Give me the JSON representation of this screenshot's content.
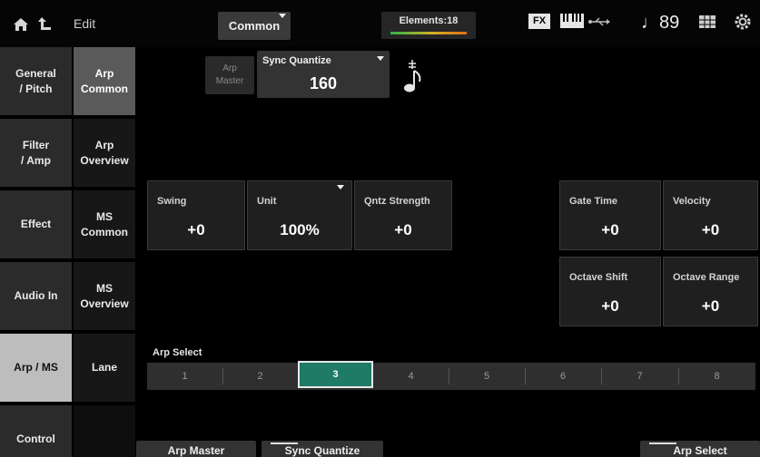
{
  "header": {
    "edit_label": "Edit",
    "common_label": "Common",
    "elements_label": "Elements:18",
    "fx_label": "FX",
    "tempo_label": "♩89",
    "icons": [
      "home-icon",
      "up-arrow-icon",
      "keyboard-icon",
      "usb-icon",
      "grid-icon",
      "gear-icon"
    ]
  },
  "nav_primary": [
    {
      "label": "General\n/ Pitch",
      "active": false
    },
    {
      "label": "Filter\n/ Amp",
      "active": false
    },
    {
      "label": "Effect",
      "active": false
    },
    {
      "label": "Audio In",
      "active": false
    },
    {
      "label": "Arp / MS",
      "active": true
    },
    {
      "label": "Control",
      "active": false
    }
  ],
  "nav_secondary": [
    {
      "label": "Arp\nCommon",
      "active": true
    },
    {
      "label": "Arp\nOverview",
      "active": false
    },
    {
      "label": "MS\nCommon",
      "active": false
    },
    {
      "label": "MS\nOverview",
      "active": false
    },
    {
      "label": "Lane",
      "active": false
    },
    {
      "label": "",
      "active": false
    }
  ],
  "arp_master": {
    "label": "Arp\nMaster"
  },
  "sync_quantize": {
    "label": "Sync Quantize",
    "value": "160",
    "icon": "note-icon"
  },
  "params": {
    "swing": {
      "label": "Swing",
      "value": "+0"
    },
    "unit": {
      "label": "Unit",
      "value": "100%"
    },
    "qntz_strength": {
      "label": "Qntz Strength",
      "value": "+0"
    },
    "gate_time": {
      "label": "Gate Time",
      "value": "+0"
    },
    "velocity": {
      "label": "Velocity",
      "value": "+0"
    },
    "octave_shift": {
      "label": "Octave Shift",
      "value": "+0"
    },
    "octave_range": {
      "label": "Octave Range",
      "value": "+0"
    }
  },
  "arp_select": {
    "label": "Arp Select",
    "options": [
      "1",
      "2",
      "3",
      "4",
      "5",
      "6",
      "7",
      "8"
    ],
    "selected": "3"
  },
  "bottom_bar": {
    "arp_master": "Arp Master",
    "sync_quantize": "Sync Quantize",
    "arp_select": "Arp Select"
  },
  "colors": {
    "accent_selected": "#1f7a66",
    "elements_bar": [
      "#2fb34a",
      "#d4b020",
      "#e0701a"
    ]
  }
}
